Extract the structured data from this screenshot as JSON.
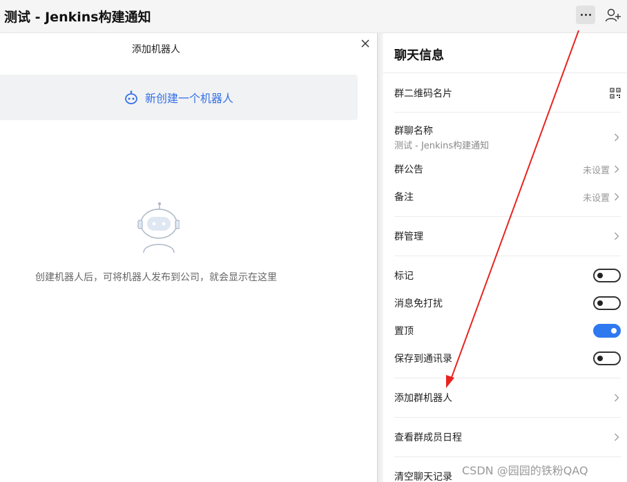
{
  "window": {
    "title": "测试 - Jenkins构建通知"
  },
  "dialog": {
    "title": "添加机器人",
    "create_robot_label": "新创建一个机器人",
    "empty_text": "创建机器人后，可将机器人发布到公司，就会显示在这里"
  },
  "chat_info": {
    "title": "聊天信息",
    "qr_label": "群二维码名片",
    "group_name_label": "群聊名称",
    "group_name_value": "测试 - Jenkins构建通知",
    "announcement_label": "群公告",
    "announcement_value": "未设置",
    "remark_label": "备注",
    "remark_value": "未设置",
    "manage_label": "群管理",
    "mark_label": "标记",
    "mark_on": false,
    "dnd_label": "消息免打扰",
    "dnd_on": false,
    "pin_label": "置顶",
    "pin_on": true,
    "save_contacts_label": "保存到通讯录",
    "save_contacts_on": false,
    "add_robot_label": "添加群机器人",
    "member_schedule_label": "查看群成员日程",
    "clear_history_label": "清空聊天记录"
  },
  "watermark": "CSDN @园园的铁粉QAQ",
  "colors": {
    "accent": "#3370e6",
    "toggle_on": "#2f79f0",
    "annotation_arrow": "#e8231f"
  },
  "icons": {
    "more": "more-dots-icon",
    "add_user": "add-user-icon",
    "close": "close-icon",
    "robot": "robot-icon",
    "qr": "qr-code-icon",
    "chevron": "chevron-right-icon"
  }
}
